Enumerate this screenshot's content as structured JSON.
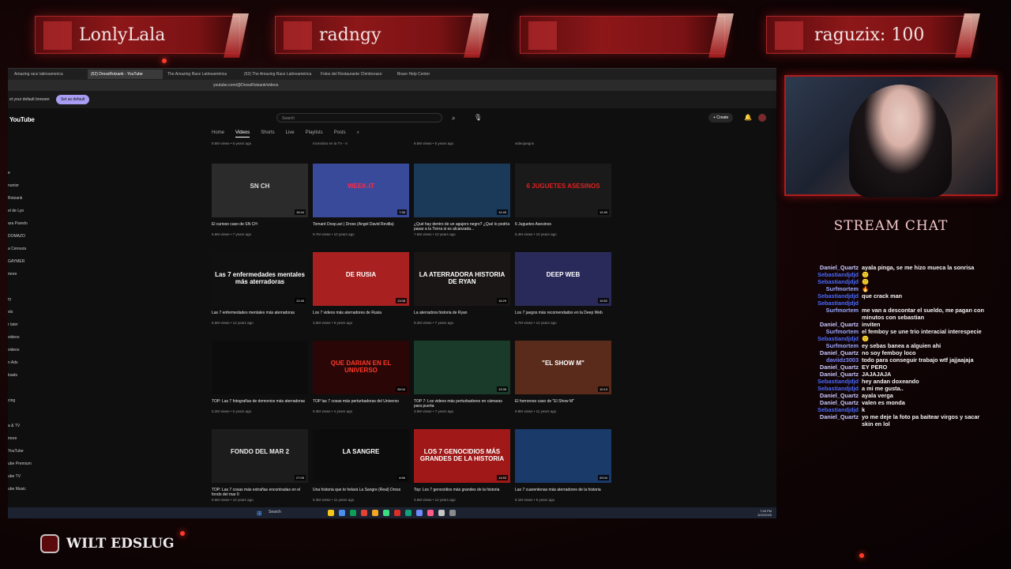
{
  "banners": [
    {
      "name": "LonlyLala"
    },
    {
      "name": "radngy"
    },
    {
      "name": ""
    },
    {
      "name": "raguzix: 100"
    }
  ],
  "browser": {
    "tabs": [
      "Amazing race latinoamerica",
      "(52) DrossRotzank - YouTube",
      "The Amazing Race Latinoamérica",
      "(52) The Amazing Race Latinoamérica",
      "Fotos del Restaurante Chimborazo",
      "Brave Help Center"
    ],
    "url": "youtube.com/@DrossRotzank/videos",
    "default_prompt": "et your default browser",
    "default_button": "Set as default"
  },
  "youtube": {
    "logo": "YouTube",
    "search_placeholder": "Search",
    "create_label": "+ Create",
    "sidebar": [
      "",
      "",
      "e",
      "nunior",
      "Rotzank",
      "el de Lyn",
      "ara Paredo",
      "DOMAZO",
      "a Censura",
      "GAYMER",
      "more",
      "",
      "ry",
      "sts",
      "r later",
      "videos",
      "videos",
      "n Ads",
      "loads",
      "",
      "cing",
      "",
      "a & TV",
      "more",
      "YouTube",
      "ube Premium",
      "ube TV",
      "ube Music"
    ],
    "channel_tabs": [
      "Home",
      "Videos",
      "Shorts",
      "Live",
      "Playlists",
      "Posts"
    ],
    "top_meta": [
      "9.5M views • 6 years ago",
      "Incendios en la TV - II",
      "9.5M views • 5 years ago",
      "videojuegos"
    ],
    "rows": [
      [
        {
          "title": "El curioso caso de SN CH",
          "meta": "5.6M views • 7 years ago",
          "dur": "15:44",
          "thumb_text": "SN CH",
          "bg": "#2b2b2b",
          "fg": "#ddd"
        },
        {
          "title": "Tomaré Dosp.avi | Dross (Angel David Revilla)",
          "meta": "9.7M views • 10 years ago",
          "dur": "7:30",
          "thumb_text": "WEEK-IT",
          "bg": "#3a4a9a",
          "fg": "#ff2a4a"
        },
        {
          "title": "¿Qué hay dentro de un agujero negro? ¿Qué lo podría pasar a la Tierra si es alcanzada...",
          "meta": "7.6M views • 10 years ago",
          "dur": "12:45",
          "thumb_text": "",
          "bg": "#1b3a5a",
          "fg": "#fff"
        },
        {
          "title": "6 Juguetes Asesinos",
          "meta": "8.4M views • 10 years ago",
          "dur": "12:40",
          "thumb_text": "6 JUGUETES ASESINOS",
          "bg": "#1a1a1a",
          "fg": "#e02020"
        }
      ],
      [
        {
          "title": "Las 7 enfermedades mentales más aterradoras",
          "meta": "5.6M views • 12 years ago",
          "dur": "12:45",
          "thumb_text": "Las 7 enfermedades mentales más aterradoras",
          "bg": "#101010",
          "fg": "#fff"
        },
        {
          "title": "Los 7 videos más aterradores de Rusia",
          "meta": "3.5M views • 9 years ago",
          "dur": "13:08",
          "thumb_text": "DE RUSIA",
          "bg": "#a82020",
          "fg": "#fff"
        },
        {
          "title": "La aterradora historia de Ryan",
          "meta": "9.2M views • 7 years ago",
          "dur": "16:29",
          "thumb_text": "LA ATERRADORA HISTORIA DE RYAN",
          "bg": "#1a1616",
          "fg": "#fff"
        },
        {
          "title": "Los 7 juegos más recomendados en la Deep Web",
          "meta": "5.7M views • 12 years ago",
          "dur": "10:52",
          "thumb_text": "DEEP WEB",
          "bg": "#2a2a5a",
          "fg": "#fff"
        }
      ],
      [
        {
          "title": "TOP: Las 7 fotografías de demonios más aterradoras",
          "meta": "5.2M views • 6 years ago",
          "dur": "",
          "thumb_text": "",
          "bg": "#0c0c0c",
          "fg": "#fff"
        },
        {
          "title": "TOP las 7 cosas más perturbadoras del Universo",
          "meta": "9.3M views • 4 years ago",
          "dur": "28:04",
          "thumb_text": "QUE DARIAN EN EL UNIVERSO",
          "bg": "#2a0606",
          "fg": "#ff3a2a"
        },
        {
          "title": "TOP 7: Los videos más perturbadores en cámaras para puerta",
          "meta": "3.9M views • 7 years ago",
          "dur": "13:35",
          "thumb_text": "",
          "bg": "#1a3a2a",
          "fg": "#fff"
        },
        {
          "title": "El horroroso caso de \"El Show M\"",
          "meta": "9.9M views • 11 years ago",
          "dur": "10:13",
          "thumb_text": "\"EL SHOW M\"",
          "bg": "#5a2a1a",
          "fg": "#fff"
        }
      ],
      [
        {
          "title": "TOP: Las 7 cosas más extrañas encontradas en el fondo del mar II",
          "meta": "9.6M views • 10 years ago",
          "dur": "27:09",
          "thumb_text": "FONDO DEL MAR 2",
          "bg": "#1c1c1c",
          "fg": "#eee"
        },
        {
          "title": "Una historia que te helará La Sangre (Real) Dross",
          "meta": "5.3M views • 11 years ago",
          "dur": "8:56",
          "thumb_text": "LA SANGRE",
          "bg": "#0c0c0c",
          "fg": "#fff"
        },
        {
          "title": "Top: Los 7 genocidios más grandes de la historia",
          "meta": "3.6M views • 12 years ago",
          "dur": "14:53",
          "thumb_text": "LOS 7 GENOCIDIOS MÁS GRANDES DE LA HISTORIA",
          "bg": "#a01818",
          "fg": "#fff"
        },
        {
          "title": "Las 7 cuarentenas más aterradores de la historia",
          "meta": "8.1M views • 5 years ago",
          "dur": "20:04",
          "thumb_text": "",
          "bg": "#1a3a6a",
          "fg": "#fff"
        }
      ]
    ]
  },
  "taskbar": {
    "search": "Search",
    "time": "7:26 PM",
    "date": "3/22/2025",
    "app_colors": [
      "#f5c518",
      "#4a8ef0",
      "#0f9d58",
      "#e34234",
      "#f5a623",
      "#3ddc84",
      "#d93025",
      "#12a07a",
      "#6c8cff",
      "#ff5b8a",
      "#c5c5c5",
      "#8a8a8a"
    ]
  },
  "stream": {
    "chat_title": "STREAM CHAT",
    "brand": "WILT EDSLUG",
    "messages": [
      {
        "user": "Daniel_Quartz",
        "color": "#c8c8ff",
        "text": "ayala pinga, se me hizo mueca la sonrisa"
      },
      {
        "user": "Sebastiandjdjd",
        "color": "#4a6aff",
        "text": "🙂"
      },
      {
        "user": "Sebastiandjdjd",
        "color": "#4a6aff",
        "text": "🙂"
      },
      {
        "user": "Surfmortem",
        "color": "#9aa8ff",
        "text": "🔥"
      },
      {
        "user": "Sebastiandjdjd",
        "color": "#4a6aff",
        "text": "que crack man"
      },
      {
        "user": "Sebastiandjdjd",
        "color": "#4a6aff",
        "text": ""
      },
      {
        "user": "Surfmortem",
        "color": "#9aa8ff",
        "text": "me van a descontar el sueldo, me pagan con minutos con sebastian"
      },
      {
        "user": "Daniel_Quartz",
        "color": "#c8c8ff",
        "text": "inviten"
      },
      {
        "user": "Surfmortem",
        "color": "#9aa8ff",
        "text": "el femboy se une trio interacial interespecie"
      },
      {
        "user": "Sebastiandjdjd",
        "color": "#4a6aff",
        "text": "🙂"
      },
      {
        "user": "Surfmortem",
        "color": "#9aa8ff",
        "text": "ey sebas banea a alguien ahi"
      },
      {
        "user": "Daniel_Quartz",
        "color": "#c8c8ff",
        "text": "no soy femboy loco"
      },
      {
        "user": "daviidz3003",
        "color": "#7a8aff",
        "text": "todo para conseguir trabajo wtf jajjaajaja"
      },
      {
        "user": "Daniel_Quartz",
        "color": "#c8c8ff",
        "text": "EY PERO"
      },
      {
        "user": "Daniel_Quartz",
        "color": "#c8c8ff",
        "text": "JAJAJAJA"
      },
      {
        "user": "Sebastiandjdjd",
        "color": "#4a6aff",
        "text": "hey andan doxeando"
      },
      {
        "user": "Sebastiandjdjd",
        "color": "#4a6aff",
        "text": "a mi me gusta.."
      },
      {
        "user": "Daniel_Quartz",
        "color": "#c8c8ff",
        "text": "ayala verga"
      },
      {
        "user": "Daniel_Quartz",
        "color": "#c8c8ff",
        "text": "valen es monda"
      },
      {
        "user": "Sebastiandjdjd",
        "color": "#4a6aff",
        "text": "k"
      },
      {
        "user": "Daniel_Quartz",
        "color": "#c8c8ff",
        "text": "yo me deje la foto pa baitear virgos y sacar skin en lol"
      }
    ]
  }
}
